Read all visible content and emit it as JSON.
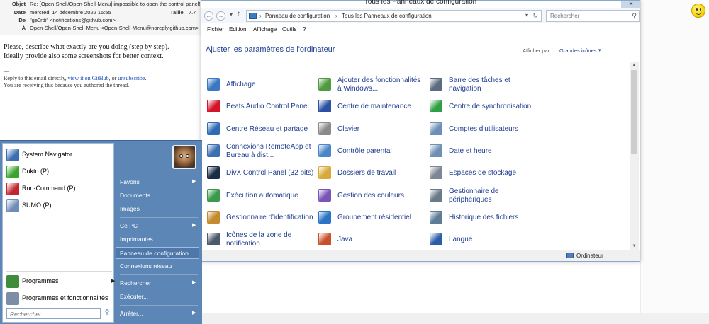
{
  "email": {
    "header": {
      "objet_label": "Objet",
      "objet_value": "Re: [Open-Shell/Open-Shell-Menu] impossible to open the control panel! (Issue",
      "date_label": "Date",
      "date_value": "mercredi 14 décembre 2022 16:55",
      "taille_label": "Taille",
      "taille_value": "7.7",
      "de_label": "De",
      "de_value": "\"ge0rdi\" <notifications@github.com>",
      "a_label": "À",
      "a_value": "Open-Shell/Open-Shell-Menu <Open-Shell-Menu@noreply.github.com>"
    },
    "body_line1": "Please, describe what exactly are you doing (step by step).",
    "body_line2": "Ideally provide also some screenshots for better context.",
    "sig_dash": "—",
    "reply_text": "Reply to this email directly,",
    "reply_link_github": "view it on GitHub",
    "reply_or": ", or",
    "reply_link_unsub": "unsubscribe",
    "reply_end": ".",
    "reason_text": "You are receiving this because you authored the thread."
  },
  "control_panel": {
    "title": "Tous les Panneaux de configuration",
    "caption_btn": "✕",
    "nav_back": "←",
    "nav_forward": "→",
    "nav_up": "↑",
    "breadcrumb": [
      "Panneau de configuration",
      "Tous les Panneaux de configuration"
    ],
    "crumb_sep": "›",
    "search_placeholder": "Rechercher",
    "menu": [
      "Fichier",
      "Edition",
      "Affichage",
      "Outils",
      "?"
    ],
    "heading": "Ajuster les paramètres de l'ordinateur",
    "view_label": "Afficher par :",
    "view_value": "Grandes icônes",
    "status_text": "Ordinateur",
    "items": [
      {
        "label": "Affichage",
        "color": "#3a78c3",
        "icon": "display-icon"
      },
      {
        "label": "Ajouter des fonctionnalités à Windows...",
        "color": "#4f9b3f",
        "icon": "add-features-icon"
      },
      {
        "label": "Barre des tâches et navigation",
        "color": "#5b6b80",
        "icon": "taskbar-icon"
      },
      {
        "label": "Beats Audio Control Panel",
        "color": "#d4142a",
        "icon": "beats-audio-icon"
      },
      {
        "label": "Centre de maintenance",
        "color": "#2b4fa3",
        "icon": "flag-icon"
      },
      {
        "label": "Centre de synchronisation",
        "color": "#2ea043",
        "icon": "sync-icon"
      },
      {
        "label": "Centre Réseau et partage",
        "color": "#2f6bb5",
        "icon": "network-icon"
      },
      {
        "label": "Clavier",
        "color": "#8a8a8a",
        "icon": "keyboard-icon"
      },
      {
        "label": "Comptes d'utilisateurs",
        "color": "#6b8fb6",
        "icon": "users-icon"
      },
      {
        "label": "Connexions RemoteApp et Bureau à dist...",
        "color": "#3b6fb0",
        "icon": "remoteapp-icon"
      },
      {
        "label": "Contrôle parental",
        "color": "#4a86c8",
        "icon": "parental-control-icon"
      },
      {
        "label": "Date et heure",
        "color": "#6f8fb5",
        "icon": "clock-icon"
      },
      {
        "label": "DivX Control Panel (32 bits)",
        "color": "#1b2c46",
        "icon": "divx-icon"
      },
      {
        "label": "Dossiers de travail",
        "color": "#d8a93a",
        "icon": "work-folders-icon"
      },
      {
        "label": "Espaces de stockage",
        "color": "#7d8694",
        "icon": "storage-icon"
      },
      {
        "label": "Exécution automatique",
        "color": "#3a9a4a",
        "icon": "autoplay-icon"
      },
      {
        "label": "Gestion des couleurs",
        "color": "#7a55b8",
        "icon": "color-management-icon"
      },
      {
        "label": "Gestionnaire de périphériques",
        "color": "#6a7a8a",
        "icon": "device-manager-icon"
      },
      {
        "label": "Gestionnaire d'identification",
        "color": "#c48a2e",
        "icon": "credential-manager-icon"
      },
      {
        "label": "Groupement résidentiel",
        "color": "#2a73c5",
        "icon": "homegroup-icon"
      },
      {
        "label": "Historique des fichiers",
        "color": "#5c7c98",
        "icon": "file-history-icon"
      },
      {
        "label": "Icônes de la zone de notification",
        "color": "#4c5a6a",
        "icon": "notification-area-icon"
      },
      {
        "label": "Java",
        "color": "#c8512b",
        "icon": "java-icon"
      },
      {
        "label": "Langue",
        "color": "#2a5ea8",
        "icon": "language-icon"
      }
    ]
  },
  "start_menu": {
    "pinned": [
      {
        "label": "System Navigator",
        "color": "#3b6db3",
        "icon": "system-navigator-icon"
      },
      {
        "label": "Dukto (P)",
        "color": "#3aa52e",
        "icon": "dukto-icon"
      },
      {
        "label": "Run-Command (P)",
        "color": "#c0262d",
        "icon": "run-command-icon"
      },
      {
        "label": "SUMO (P)",
        "color": "#6f8cb8",
        "icon": "sumo-icon"
      }
    ],
    "programs_label": "Programmes",
    "programs_features_label": "Programmes et fonctionnalités",
    "submenu_arrow": "▶",
    "search_placeholder": "Rechercher",
    "search_icon": "⚲",
    "right": [
      {
        "label": "Favoris",
        "arrow": true
      },
      {
        "label": "Documents",
        "arrow": false
      },
      {
        "label": "Images",
        "arrow": false
      },
      {
        "label": "Ce PC",
        "arrow": true
      },
      {
        "label": "Imprimantes",
        "arrow": false
      },
      {
        "label": "Panneau de configuration",
        "arrow": false,
        "highlight": true
      },
      {
        "label": "Connexions réseau",
        "arrow": false
      },
      {
        "label": "Rechercher",
        "arrow": true
      },
      {
        "label": "Exécuter...",
        "arrow": false
      },
      {
        "label": "Arrêter...",
        "arrow": true
      }
    ]
  }
}
